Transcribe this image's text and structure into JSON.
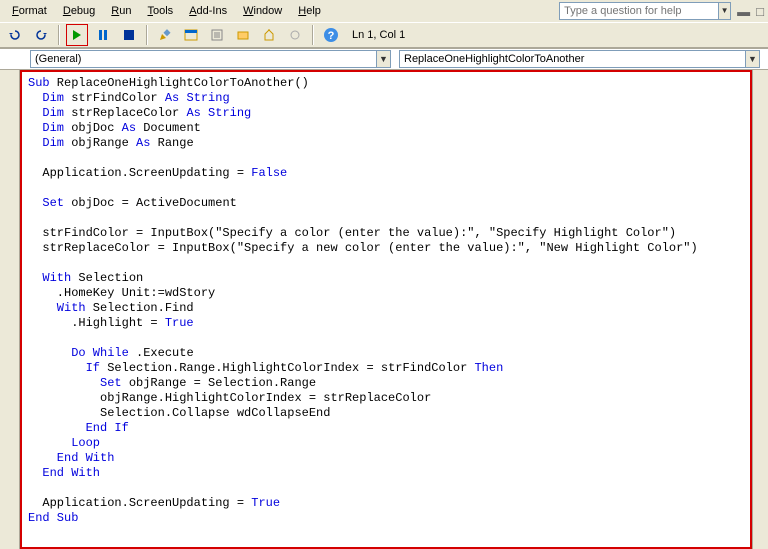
{
  "menu": {
    "format": "Format",
    "debug": "Debug",
    "run": "Run",
    "tools": "Tools",
    "addins": "Add-Ins",
    "window": "Window",
    "help": "Help"
  },
  "helpbox": {
    "placeholder": "Type a question for help"
  },
  "toolbar": {
    "cursor": "Ln 1, Col 1"
  },
  "dropdowns": {
    "left": "(General)",
    "right": "ReplaceOneHighlightColorToAnother"
  },
  "code": {
    "l1a": "Sub",
    "l1b": " ReplaceOneHighlightColorToAnother()",
    "l2a": "  Dim",
    "l2b": " strFindColor ",
    "l2c": "As String",
    "l3a": "  Dim",
    "l3b": " strReplaceColor ",
    "l3c": "As String",
    "l4a": "  Dim",
    "l4b": " objDoc ",
    "l4c": "As",
    "l4d": " Document",
    "l5a": "  Dim",
    "l5b": " objRange ",
    "l5c": "As",
    "l5d": " Range",
    "l6": "",
    "l7a": "  Application.ScreenUpdating = ",
    "l7b": "False",
    "l8": "",
    "l9a": "  Set",
    "l9b": " objDoc = ActiveDocument",
    "l10": "",
    "l11": "  strFindColor = InputBox(\"Specify a color (enter the value):\", \"Specify Highlight Color\")",
    "l12": "  strReplaceColor = InputBox(\"Specify a new color (enter the value):\", \"New Highlight Color\")",
    "l13": "",
    "l14a": "  With",
    "l14b": " Selection",
    "l15": "    .HomeKey Unit:=wdStory",
    "l16a": "    With",
    "l16b": " Selection.Find",
    "l17a": "      .Highlight = ",
    "l17b": "True",
    "l18": "",
    "l19a": "      Do While",
    "l19b": " .Execute",
    "l20a": "        If",
    "l20b": " Selection.Range.HighlightColorIndex = strFindColor ",
    "l20c": "Then",
    "l21a": "          Set",
    "l21b": " objRange = Selection.Range",
    "l22": "          objRange.HighlightColorIndex = strReplaceColor",
    "l23": "          Selection.Collapse wdCollapseEnd",
    "l24a": "        End If",
    "l25a": "      Loop",
    "l26a": "    End With",
    "l27a": "  End With",
    "l28": "",
    "l29a": "  Application.ScreenUpdating = ",
    "l29b": "True",
    "l30a": "End Sub"
  }
}
